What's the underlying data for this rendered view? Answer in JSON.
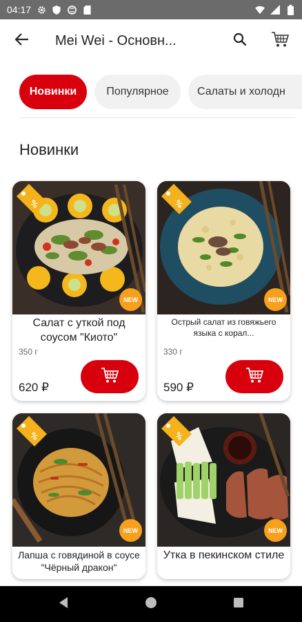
{
  "status_bar": {
    "time": "04:17",
    "left_icons": [
      "gear-icon",
      "shield-icon",
      "vpn-icon",
      "sd-card-icon"
    ],
    "right_icons": [
      "wifi-icon",
      "signal-icon",
      "battery-icon"
    ]
  },
  "app_bar": {
    "back_icon": "arrow-left-icon",
    "title": "Mei Wei - Основн...",
    "search_icon": "search-icon",
    "cart_icon": "shopping-cart-icon"
  },
  "categories": [
    {
      "label": "Новинки",
      "active": true
    },
    {
      "label": "Популярное",
      "active": false
    },
    {
      "label": "Салаты и холодн",
      "active": false
    }
  ],
  "section_title": "Новинки",
  "products": [
    {
      "name": "Салат с уткой под соусом \"Киото\"",
      "weight": "350 г",
      "price": "620 ₽",
      "badge": "NEW"
    },
    {
      "name": "Острый салат из говяжьего языка с корал...",
      "weight": "330 г",
      "price": "590 ₽",
      "badge": "NEW"
    },
    {
      "name": "Лапша с говядиной в соусе \"Чёрный дракон\"",
      "badge": "NEW"
    },
    {
      "name": "Утка в пекинском стиле",
      "badge": "NEW"
    }
  ],
  "colors": {
    "accent": "#d9000d",
    "badge_orange": "#f7a01c",
    "promo_yellow": "#f6b21a",
    "status_bar": "#6b6b6b"
  },
  "nav_bar": {
    "back": "triangle-back-icon",
    "home": "circle-home-icon",
    "recents": "square-recents-icon"
  }
}
